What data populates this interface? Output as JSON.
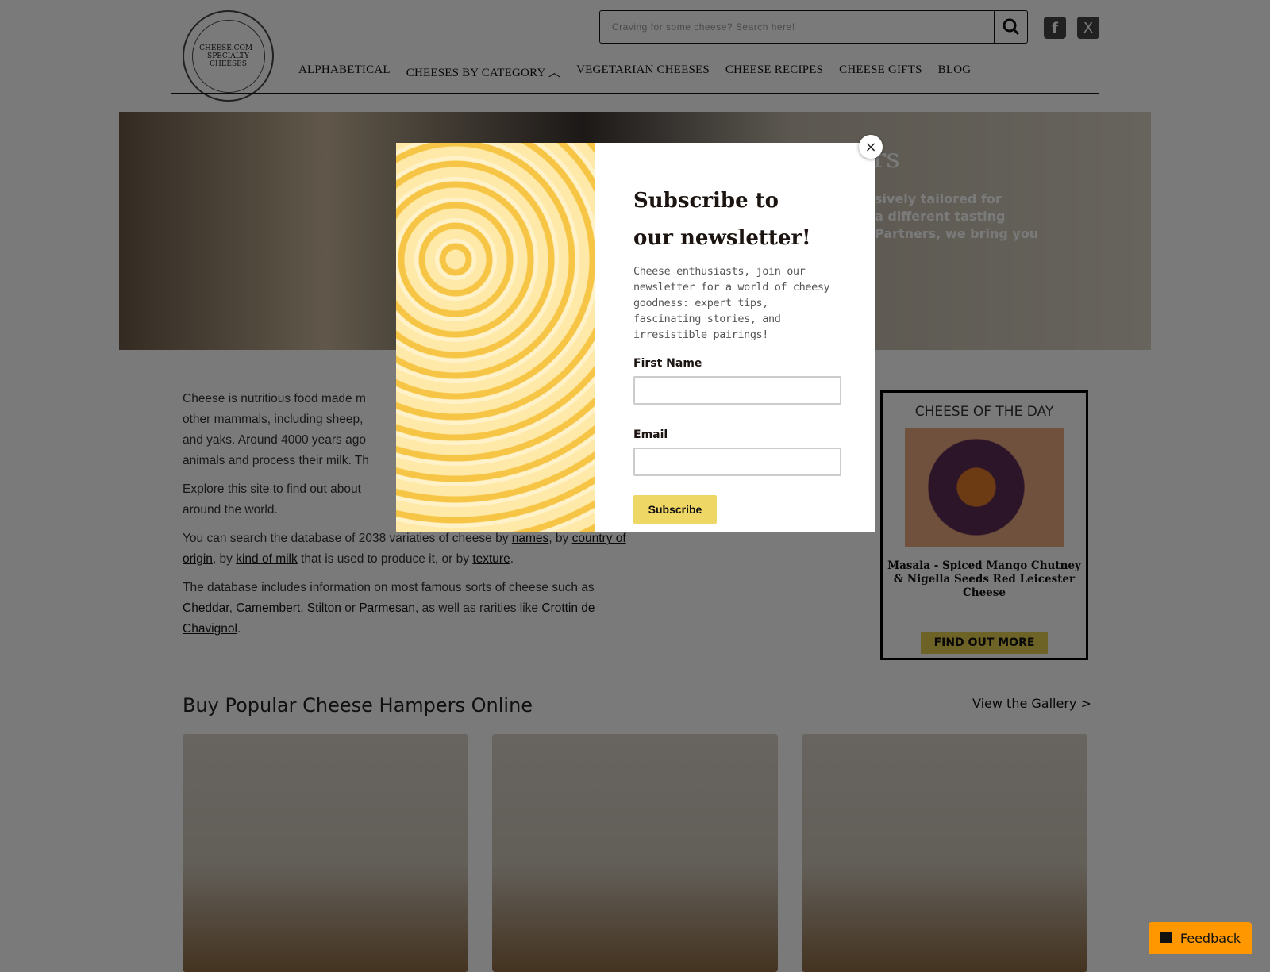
{
  "header": {
    "logo_text": "CHEESE.COM · SPECIALTY CHEESES",
    "search_placeholder": "Craving for some cheese? Search here!",
    "nav": [
      "ALPHABETICAL",
      "CHEESES BY CATEGORY",
      "VEGETARIAN CHEESES",
      "CHEESE RECIPES",
      "CHEESE GIFTS",
      "BLOG"
    ]
  },
  "hero": {
    "title_partial": "rs",
    "text": [
      "sively tailored for",
      "a different tasting",
      "Partners, we bring you"
    ]
  },
  "main": {
    "p1": "Cheese is nutritious food made m",
    "p1b": "other mammals, including sheep,",
    "p1c": "and yaks. Around 4000 years ago",
    "p1d": "animals and process their milk. Th",
    "p2": "Explore this site to find out about",
    "p2b": "around the world.",
    "p3a": "You can search the database of 2038 variaties of cheese by ",
    "names": "names",
    "p3b": ", by ",
    "country": "country of origin",
    "p3c": ", by ",
    "milk": "kind of milk",
    "p3d": " that is used to produce it, or by ",
    "texture": "texture",
    "p3e": ".",
    "p4a": "The database includes information on most famous sorts of cheese such as ",
    "cheddar": "Cheddar",
    "camembert": "Camembert",
    "stilton": "Stilton",
    "or": " or ",
    "parmesan": "Parmesan",
    "p4b": ", as well as rarities like ",
    "crottin": "Crottin de Chavignol",
    "p4c": "."
  },
  "cotd": {
    "title": "CHEESE OF THE DAY",
    "name": "Masala - Spiced Mango Chutney & Nigella Seeds Red Leicester Cheese",
    "button": "FIND OUT MORE"
  },
  "hampers": {
    "heading": "Buy Popular Cheese Hampers Online",
    "gallery_link": "View the Gallery >"
  },
  "popup": {
    "title_line1": "Subscribe to",
    "title_line2": "our newsletter!",
    "description": "Cheese enthusiasts, join our newsletter for a world of cheesy goodness: expert tips, fascinating stories, and irresistible pairings!",
    "first_name_label": "First Name",
    "email_label": "Email",
    "subscribe": "Subscribe",
    "close": "×"
  },
  "feedback": {
    "label": "Feedback"
  },
  "colors": {
    "subscribe_bg": "#efd766",
    "feedback_bg": "#ff9800",
    "cotd_button": "#e6cf4f"
  }
}
